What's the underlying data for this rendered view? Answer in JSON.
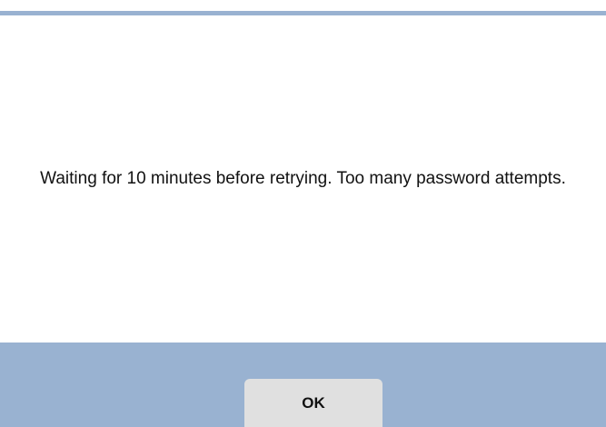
{
  "dialog": {
    "message": "Waiting for 10 minutes before retrying. Too many password attempts.",
    "ok_label": "OK"
  },
  "colors": {
    "accent": "#99b2d1",
    "button": "#e0e0e0",
    "background": "#ffffff"
  }
}
